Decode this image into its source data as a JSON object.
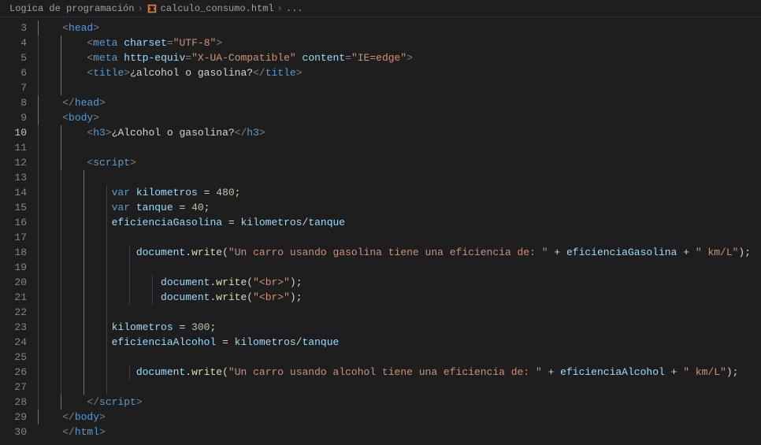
{
  "breadcrumb": {
    "folder": "Logica de programación",
    "file": "calculo_consumo.html",
    "tail": "..."
  },
  "startLine": 3,
  "activeLine": 10,
  "indentGuides": [
    {
      "row": 0,
      "cols": [
        0
      ],
      "active": [
        0
      ]
    },
    {
      "row": 1,
      "cols": [
        0,
        1
      ],
      "active": [
        1
      ]
    },
    {
      "row": 2,
      "cols": [
        0,
        1
      ],
      "active": [
        1
      ]
    },
    {
      "row": 3,
      "cols": [
        0,
        1
      ],
      "active": [
        1
      ]
    },
    {
      "row": 4,
      "cols": [
        0,
        1
      ],
      "active": [
        1
      ]
    },
    {
      "row": 5,
      "cols": [
        0
      ],
      "active": [
        0
      ]
    },
    {
      "row": 6,
      "cols": [
        0
      ],
      "active": [
        0
      ]
    },
    {
      "row": 7,
      "cols": [
        0,
        1
      ],
      "active": [
        1
      ]
    },
    {
      "row": 8,
      "cols": [
        0,
        1
      ],
      "active": [
        1
      ]
    },
    {
      "row": 9,
      "cols": [
        0,
        1
      ],
      "active": [
        1
      ]
    },
    {
      "row": 10,
      "cols": [
        0,
        1,
        2
      ],
      "active": [
        2
      ]
    },
    {
      "row": 11,
      "cols": [
        0,
        1,
        2,
        3
      ],
      "active": [
        2
      ]
    },
    {
      "row": 12,
      "cols": [
        0,
        1,
        2,
        3
      ],
      "active": [
        2
      ]
    },
    {
      "row": 13,
      "cols": [
        0,
        1,
        2,
        3
      ],
      "active": [
        2
      ]
    },
    {
      "row": 14,
      "cols": [
        0,
        1,
        2,
        3
      ],
      "active": [
        2
      ]
    },
    {
      "row": 15,
      "cols": [
        0,
        1,
        2,
        3,
        4
      ],
      "active": [
        2
      ]
    },
    {
      "row": 16,
      "cols": [
        0,
        1,
        2,
        3,
        4
      ],
      "active": [
        2
      ]
    },
    {
      "row": 17,
      "cols": [
        0,
        1,
        2,
        3,
        4,
        5
      ],
      "active": [
        2
      ]
    },
    {
      "row": 18,
      "cols": [
        0,
        1,
        2,
        3,
        4,
        5
      ],
      "active": [
        2
      ]
    },
    {
      "row": 19,
      "cols": [
        0,
        1,
        2,
        3
      ],
      "active": [
        2
      ]
    },
    {
      "row": 20,
      "cols": [
        0,
        1,
        2,
        3
      ],
      "active": [
        2
      ]
    },
    {
      "row": 21,
      "cols": [
        0,
        1,
        2,
        3
      ],
      "active": [
        2
      ]
    },
    {
      "row": 22,
      "cols": [
        0,
        1,
        2,
        3
      ],
      "active": [
        2
      ]
    },
    {
      "row": 23,
      "cols": [
        0,
        1,
        2,
        3,
        4
      ],
      "active": [
        2
      ]
    },
    {
      "row": 24,
      "cols": [
        0,
        1,
        2,
        3
      ],
      "active": [
        2
      ]
    },
    {
      "row": 25,
      "cols": [
        0,
        1
      ],
      "active": [
        1
      ]
    },
    {
      "row": 26,
      "cols": [
        0
      ],
      "active": [
        0
      ]
    },
    {
      "row": 27,
      "cols": [],
      "active": []
    }
  ],
  "lines": [
    [
      {
        "t": "    ",
        "c": ""
      },
      {
        "t": "<",
        "c": "c-punc"
      },
      {
        "t": "head",
        "c": "c-tag"
      },
      {
        "t": ">",
        "c": "c-punc"
      }
    ],
    [
      {
        "t": "        ",
        "c": ""
      },
      {
        "t": "<",
        "c": "c-punc"
      },
      {
        "t": "meta",
        "c": "c-tag"
      },
      {
        "t": " ",
        "c": ""
      },
      {
        "t": "charset",
        "c": "c-attr"
      },
      {
        "t": "=",
        "c": "c-punc"
      },
      {
        "t": "\"UTF-8\"",
        "c": "c-str"
      },
      {
        "t": ">",
        "c": "c-punc"
      }
    ],
    [
      {
        "t": "        ",
        "c": ""
      },
      {
        "t": "<",
        "c": "c-punc"
      },
      {
        "t": "meta",
        "c": "c-tag"
      },
      {
        "t": " ",
        "c": ""
      },
      {
        "t": "http-equiv",
        "c": "c-attr"
      },
      {
        "t": "=",
        "c": "c-punc"
      },
      {
        "t": "\"X-UA-Compatible\"",
        "c": "c-str"
      },
      {
        "t": " ",
        "c": ""
      },
      {
        "t": "content",
        "c": "c-attr"
      },
      {
        "t": "=",
        "c": "c-punc"
      },
      {
        "t": "\"IE=edge\"",
        "c": "c-str"
      },
      {
        "t": ">",
        "c": "c-punc"
      }
    ],
    [
      {
        "t": "        ",
        "c": ""
      },
      {
        "t": "<",
        "c": "c-punc"
      },
      {
        "t": "title",
        "c": "c-tag"
      },
      {
        "t": ">",
        "c": "c-punc"
      },
      {
        "t": "¿alcohol o gasolina?",
        "c": "c-text"
      },
      {
        "t": "</",
        "c": "c-punc"
      },
      {
        "t": "title",
        "c": "c-tag"
      },
      {
        "t": ">",
        "c": "c-punc"
      }
    ],
    [
      {
        "t": "",
        "c": ""
      }
    ],
    [
      {
        "t": "    ",
        "c": ""
      },
      {
        "t": "</",
        "c": "c-punc"
      },
      {
        "t": "head",
        "c": "c-tag"
      },
      {
        "t": ">",
        "c": "c-punc"
      }
    ],
    [
      {
        "t": "    ",
        "c": ""
      },
      {
        "t": "<",
        "c": "c-punc"
      },
      {
        "t": "body",
        "c": "c-tag"
      },
      {
        "t": ">",
        "c": "c-punc"
      }
    ],
    [
      {
        "t": "        ",
        "c": ""
      },
      {
        "t": "<",
        "c": "c-punc"
      },
      {
        "t": "h3",
        "c": "c-tag"
      },
      {
        "t": ">",
        "c": "c-punc"
      },
      {
        "t": "¿Alcohol o gasolina?",
        "c": "c-text"
      },
      {
        "t": "</",
        "c": "c-punc"
      },
      {
        "t": "h3",
        "c": "c-tag"
      },
      {
        "t": ">",
        "c": "c-punc"
      }
    ],
    [
      {
        "t": "",
        "c": ""
      }
    ],
    [
      {
        "t": "        ",
        "c": ""
      },
      {
        "t": "<",
        "c": "c-punc"
      },
      {
        "t": "script",
        "c": "c-tag"
      },
      {
        "t": ">",
        "c": "c-punc"
      }
    ],
    [
      {
        "t": "",
        "c": ""
      }
    ],
    [
      {
        "t": "            ",
        "c": ""
      },
      {
        "t": "var",
        "c": "c-kw"
      },
      {
        "t": " ",
        "c": ""
      },
      {
        "t": "kilometros",
        "c": "c-var"
      },
      {
        "t": " = ",
        "c": "c-op"
      },
      {
        "t": "480",
        "c": "c-num"
      },
      {
        "t": ";",
        "c": "c-text"
      }
    ],
    [
      {
        "t": "            ",
        "c": ""
      },
      {
        "t": "var",
        "c": "c-kw"
      },
      {
        "t": " ",
        "c": ""
      },
      {
        "t": "tanque",
        "c": "c-var"
      },
      {
        "t": " = ",
        "c": "c-op"
      },
      {
        "t": "40",
        "c": "c-num"
      },
      {
        "t": ";",
        "c": "c-text"
      }
    ],
    [
      {
        "t": "            ",
        "c": ""
      },
      {
        "t": "eficienciaGasolina",
        "c": "c-var"
      },
      {
        "t": " = ",
        "c": "c-op"
      },
      {
        "t": "kilometros",
        "c": "c-var"
      },
      {
        "t": "/",
        "c": "c-op"
      },
      {
        "t": "tanque",
        "c": "c-var"
      }
    ],
    [
      {
        "t": "",
        "c": ""
      }
    ],
    [
      {
        "t": "                ",
        "c": ""
      },
      {
        "t": "document",
        "c": "c-obj"
      },
      {
        "t": ".",
        "c": "c-text"
      },
      {
        "t": "write",
        "c": "c-func"
      },
      {
        "t": "(",
        "c": "c-text"
      },
      {
        "t": "\"Un carro usando gasolina tiene una eficiencia de: \"",
        "c": "c-str"
      },
      {
        "t": " + ",
        "c": "c-op"
      },
      {
        "t": "eficienciaGasolina",
        "c": "c-var"
      },
      {
        "t": " + ",
        "c": "c-op"
      },
      {
        "t": "\" km/L\"",
        "c": "c-str"
      },
      {
        "t": ");",
        "c": "c-text"
      }
    ],
    [
      {
        "t": "",
        "c": ""
      }
    ],
    [
      {
        "t": "                    ",
        "c": ""
      },
      {
        "t": "document",
        "c": "c-obj"
      },
      {
        "t": ".",
        "c": "c-text"
      },
      {
        "t": "write",
        "c": "c-func"
      },
      {
        "t": "(",
        "c": "c-text"
      },
      {
        "t": "\"<br>\"",
        "c": "c-str"
      },
      {
        "t": ");",
        "c": "c-text"
      }
    ],
    [
      {
        "t": "                    ",
        "c": ""
      },
      {
        "t": "document",
        "c": "c-obj"
      },
      {
        "t": ".",
        "c": "c-text"
      },
      {
        "t": "write",
        "c": "c-func"
      },
      {
        "t": "(",
        "c": "c-text"
      },
      {
        "t": "\"<br>\"",
        "c": "c-str"
      },
      {
        "t": ");",
        "c": "c-text"
      }
    ],
    [
      {
        "t": "",
        "c": ""
      }
    ],
    [
      {
        "t": "            ",
        "c": ""
      },
      {
        "t": "kilometros",
        "c": "c-var"
      },
      {
        "t": " = ",
        "c": "c-op"
      },
      {
        "t": "300",
        "c": "c-num"
      },
      {
        "t": ";",
        "c": "c-text"
      }
    ],
    [
      {
        "t": "            ",
        "c": ""
      },
      {
        "t": "eficienciaAlcohol",
        "c": "c-var"
      },
      {
        "t": " = ",
        "c": "c-op"
      },
      {
        "t": "kilometros",
        "c": "c-var"
      },
      {
        "t": "/",
        "c": "c-op"
      },
      {
        "t": "tanque",
        "c": "c-var"
      }
    ],
    [
      {
        "t": "",
        "c": ""
      }
    ],
    [
      {
        "t": "                ",
        "c": ""
      },
      {
        "t": "document",
        "c": "c-obj"
      },
      {
        "t": ".",
        "c": "c-text"
      },
      {
        "t": "write",
        "c": "c-func"
      },
      {
        "t": "(",
        "c": "c-text"
      },
      {
        "t": "\"Un carro usando alcohol tiene una eficiencia de: \"",
        "c": "c-str"
      },
      {
        "t": " + ",
        "c": "c-op"
      },
      {
        "t": "eficienciaAlcohol",
        "c": "c-var"
      },
      {
        "t": " + ",
        "c": "c-op"
      },
      {
        "t": "\" km/L\"",
        "c": "c-str"
      },
      {
        "t": ");",
        "c": "c-text"
      }
    ],
    [
      {
        "t": "",
        "c": ""
      }
    ],
    [
      {
        "t": "        ",
        "c": ""
      },
      {
        "t": "</",
        "c": "c-punc"
      },
      {
        "t": "script",
        "c": "c-tag"
      },
      {
        "t": ">",
        "c": "c-punc"
      }
    ],
    [
      {
        "t": "    ",
        "c": ""
      },
      {
        "t": "</",
        "c": "c-punc"
      },
      {
        "t": "body",
        "c": "c-tag"
      },
      {
        "t": ">",
        "c": "c-punc"
      }
    ],
    [
      {
        "t": "    ",
        "c": ""
      },
      {
        "t": "</",
        "c": "c-punc"
      },
      {
        "t": "html",
        "c": "c-tag"
      },
      {
        "t": ">",
        "c": "c-punc"
      }
    ]
  ]
}
